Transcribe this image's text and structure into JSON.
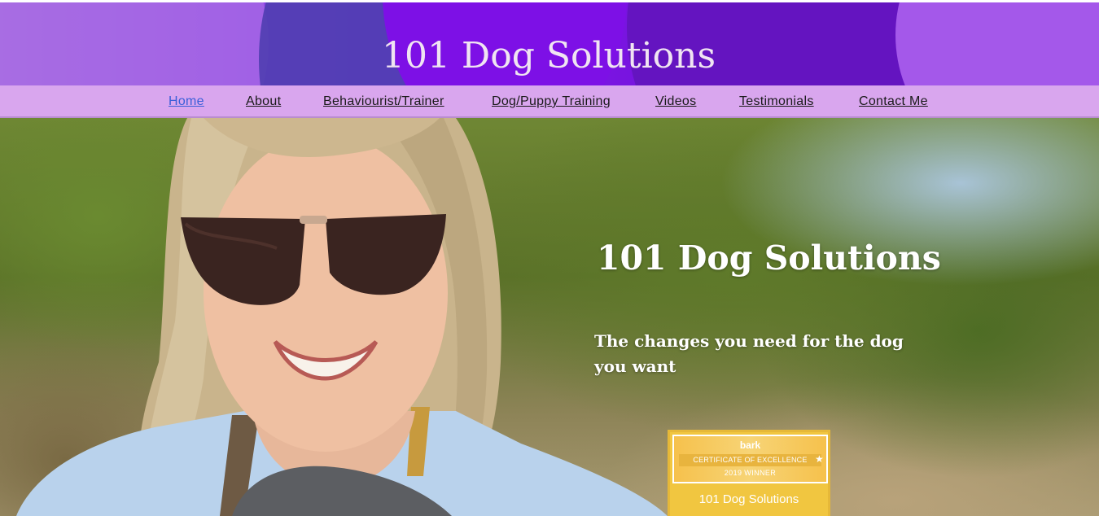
{
  "site": {
    "title": "101 Dog Solutions"
  },
  "nav": {
    "items": [
      {
        "label": "Home",
        "active": true
      },
      {
        "label": "About",
        "active": false
      },
      {
        "label": "Behaviourist/Trainer",
        "active": false
      },
      {
        "label": "Dog/Puppy Training",
        "active": false
      },
      {
        "label": "Videos",
        "active": false
      },
      {
        "label": "Testimonials",
        "active": false
      },
      {
        "label": "Contact Me",
        "active": false
      }
    ]
  },
  "hero": {
    "title": "101 Dog Solutions",
    "tagline": "The changes you need for the dog you want"
  },
  "badge": {
    "brand": "bark",
    "certificate": "CERTIFICATE OF EXCELLENCE",
    "year": "2019 WINNER",
    "name": "101 Dog Solutions"
  },
  "colors": {
    "header_purple": "#7a14e2",
    "nav_background": "#d9a6ee",
    "active_link": "#3a5fd8",
    "badge_gold": "#f1c640"
  }
}
